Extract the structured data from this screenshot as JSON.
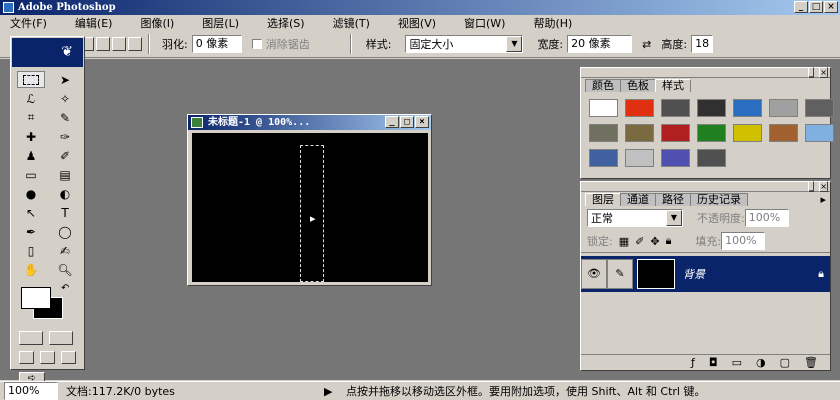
{
  "window": {
    "title": "Adobe Photoshop"
  },
  "menu": [
    "文件(F)",
    "编辑(E)",
    "图像(I)",
    "图层(L)",
    "选择(S)",
    "滤镜(T)",
    "视图(V)",
    "窗口(W)",
    "帮助(H)"
  ],
  "options": {
    "feather_label": "羽化:",
    "feather_value": "0 像素",
    "antialias_label": "消除锯齿",
    "style_label": "样式:",
    "style_value": "固定大小",
    "width_label": "宽度:",
    "width_value": "20 像素",
    "height_label": "高度:",
    "height_value": "18"
  },
  "document": {
    "title": "未标题-1 @ 100%..."
  },
  "color_panel": {
    "tabs": [
      "颜色",
      "色板",
      "样式"
    ],
    "active_tab": "样式",
    "swatch_colors": [
      "#ffffff",
      "#e03010",
      "#505050",
      "#303030",
      "#2a6fbf",
      "#a0a0a0",
      "#606060",
      "#707060",
      "#7a6a40",
      "#b02020",
      "#208020",
      "#d0c000",
      "#a06030",
      "#80b0e0",
      "#4060a0",
      "#c0c0c0",
      "#5050b0",
      "#505050"
    ]
  },
  "layers_panel": {
    "tabs": [
      "图层",
      "通道",
      "路径",
      "历史记录"
    ],
    "active_tab": "图层",
    "blend_mode": "正常",
    "opacity_label": "不透明度:",
    "opacity_value": "100%",
    "lock_label": "锁定:",
    "fill_label": "填充:",
    "fill_value": "100%",
    "layer_name": "背景"
  },
  "status": {
    "zoom": "100%",
    "doc_info": "文档:117.2K/0 bytes",
    "hint": "点按并拖移以移动选区外框。要用附加选项，使用 Shift、Alt 和 Ctrl 键。"
  },
  "colors": {
    "title_start": "#0a246a",
    "title_end": "#a6caf0",
    "workspace": "#767676",
    "selected_layer": "#0a246a"
  }
}
